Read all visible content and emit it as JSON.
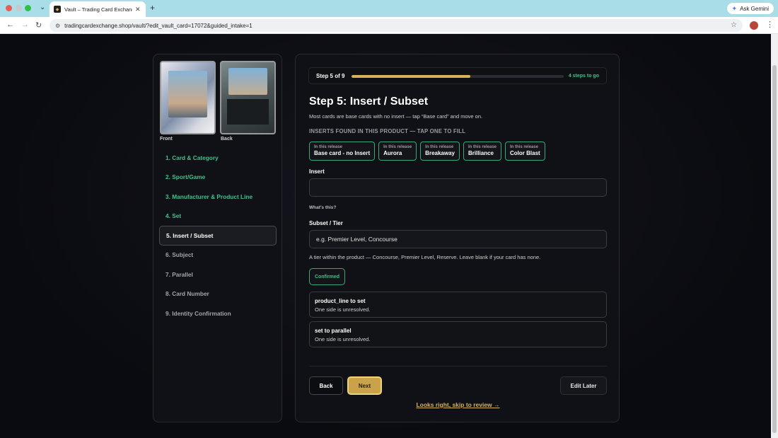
{
  "browser": {
    "tab_title": "Vault – Trading Card Exchange",
    "url": "tradingcardexchange.shop/vault/?edit_vault_card=17072&guided_intake=1",
    "gemini_label": "Ask Gemini"
  },
  "sidebar": {
    "front_label": "Front",
    "back_label": "Back",
    "steps": [
      {
        "label": "1. Card & Category",
        "state": "done"
      },
      {
        "label": "2. Sport/Game",
        "state": "done"
      },
      {
        "label": "3. Manufacturer & Product Line",
        "state": "done"
      },
      {
        "label": "4. Set",
        "state": "done"
      },
      {
        "label": "5. Insert / Subset",
        "state": "active"
      },
      {
        "label": "6. Subject",
        "state": "todo"
      },
      {
        "label": "7. Parallel",
        "state": "todo"
      },
      {
        "label": "8. Card Number",
        "state": "todo"
      },
      {
        "label": "9. Identity Confirmation",
        "state": "todo"
      }
    ]
  },
  "progress": {
    "label": "Step 5 of 9",
    "fraction": 0.56,
    "remaining": "4 steps to go"
  },
  "step": {
    "title": "Step 5: Insert / Subset",
    "description": "Most cards are base cards with no insert — tap “Base card” and move on.",
    "inserts_heading": "INSERTS FOUND IN THIS PRODUCT — TAP ONE TO FILL",
    "chips": [
      {
        "sub": "In this release",
        "main": "Base card - no Insert"
      },
      {
        "sub": "In this release",
        "main": "Aurora"
      },
      {
        "sub": "In this release",
        "main": "Breakaway"
      },
      {
        "sub": "In this release",
        "main": "Brilliance"
      },
      {
        "sub": "In this release",
        "main": "Color Blast"
      }
    ],
    "insert_label": "Insert",
    "insert_value": "",
    "whats_this": "What's this?",
    "subset_label": "Subset / Tier",
    "subset_placeholder": "e.g. Premier Level, Concourse",
    "subset_help": "A tier within the product — Concourse, Premier Level, Reserve. Leave blank if your card has none.",
    "confirmed_label": "Confirmed",
    "issues": [
      {
        "title": "product_line to set",
        "desc": "One side is unresolved."
      },
      {
        "title": "set to parallel",
        "desc": "One side is unresolved."
      }
    ]
  },
  "actions": {
    "back": "Back",
    "next": "Next",
    "later": "Edit Later",
    "skip": "Looks right, skip to review →"
  },
  "colors": {
    "accent_gold": "#d6b25a",
    "success_green": "#3ec28a",
    "background": "#0a0b10"
  }
}
